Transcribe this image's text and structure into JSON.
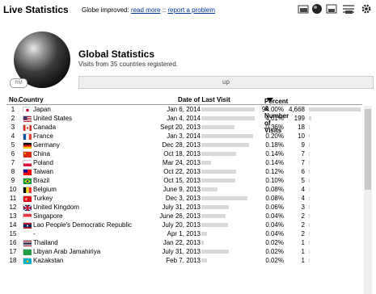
{
  "header": {
    "title": "Live Statistics",
    "message": "Globe improved:",
    "read_more": "read more",
    "separator": "::",
    "report": "report a problem",
    "icons": [
      "map-2d-icon",
      "globe-3d-icon",
      "fullscreen-icon",
      "tools-icon",
      "gear-icon"
    ]
  },
  "globe": {
    "badge": "RM"
  },
  "summary": {
    "title": "Global Statistics",
    "subtitle": "Visits from 35 countries registered.",
    "up_label": "up"
  },
  "table": {
    "headers": {
      "no": "No.",
      "country": "Country",
      "date": "Date of Last Visit",
      "percent": "Percent & Number of Visits"
    },
    "rows": [
      {
        "n": "1",
        "country": "Japan",
        "date": "Jan 6, 2014",
        "pct": "94.00%",
        "cnt": "4,668",
        "frac": 1.0,
        "flag": "jp"
      },
      {
        "n": "2",
        "country": "United States",
        "date": "Jan 4, 2014",
        "pct": "4.01%",
        "cnt": "199",
        "frac": 0.04,
        "flag": "us"
      },
      {
        "n": "3",
        "country": "Canada",
        "date": "Sept 20, 2013",
        "pct": "0.36%",
        "cnt": "18",
        "frac": 0.0036,
        "flag": "ca"
      },
      {
        "n": "4",
        "country": "France",
        "date": "Jan 3, 2014",
        "pct": "0.20%",
        "cnt": "10",
        "frac": 0.002,
        "flag": "fr"
      },
      {
        "n": "5",
        "country": "Germany",
        "date": "Dec 28, 2013",
        "pct": "0.18%",
        "cnt": "9",
        "frac": 0.0018,
        "flag": "de"
      },
      {
        "n": "6",
        "country": "China",
        "date": "Oct 18, 2013",
        "pct": "0.14%",
        "cnt": "7",
        "frac": 0.0014,
        "flag": "cn"
      },
      {
        "n": "7",
        "country": "Poland",
        "date": "Mar 24, 2013",
        "pct": "0.14%",
        "cnt": "7",
        "frac": 0.0014,
        "flag": "pl"
      },
      {
        "n": "8",
        "country": "Taiwan",
        "date": "Oct 22, 2013",
        "pct": "0.12%",
        "cnt": "6",
        "frac": 0.0012,
        "flag": "tw"
      },
      {
        "n": "9",
        "country": "Brazil",
        "date": "Oct 15, 2013",
        "pct": "0.10%",
        "cnt": "5",
        "frac": 0.001,
        "flag": "br"
      },
      {
        "n": "10",
        "country": "Belgium",
        "date": "June 9, 2013",
        "pct": "0.08%",
        "cnt": "4",
        "frac": 0.0008,
        "flag": "be"
      },
      {
        "n": "11",
        "country": "Turkey",
        "date": "Dec 3, 2013",
        "pct": "0.08%",
        "cnt": "4",
        "frac": 0.0008,
        "flag": "tr"
      },
      {
        "n": "12",
        "country": "United Kingdom",
        "date": "July 31, 2013",
        "pct": "0.06%",
        "cnt": "3",
        "frac": 0.0006,
        "flag": "gb"
      },
      {
        "n": "13",
        "country": "Singapore",
        "date": "June 26, 2013",
        "pct": "0.04%",
        "cnt": "2",
        "frac": 0.0004,
        "flag": "sg"
      },
      {
        "n": "14",
        "country": "Lao People's Democratic Republic",
        "date": "July 20, 2013",
        "pct": "0.04%",
        "cnt": "2",
        "frac": 0.0004,
        "flag": "la"
      },
      {
        "n": "15",
        "country": "-",
        "date": "Apr 1, 2013",
        "pct": "0.04%",
        "cnt": "2",
        "frac": 0.0004,
        "flag": "none"
      },
      {
        "n": "16",
        "country": "Thailand",
        "date": "Jan 22, 2013",
        "pct": "0.02%",
        "cnt": "1",
        "frac": 0.0002,
        "flag": "th"
      },
      {
        "n": "17",
        "country": "Libyan Arab Jamahiriya",
        "date": "July 31, 2013",
        "pct": "0.02%",
        "cnt": "1",
        "frac": 0.0002,
        "flag": "ly"
      },
      {
        "n": "18",
        "country": "Kazakstan",
        "date": "Feb 7, 2013",
        "pct": "0.02%",
        "cnt": "1",
        "frac": 0.0002,
        "flag": "kz"
      }
    ],
    "date_bar_fracs": [
      1.0,
      1.0,
      0.62,
      0.97,
      0.9,
      0.65,
      0.18,
      0.65,
      0.63,
      0.3,
      0.86,
      0.52,
      0.45,
      0.5,
      0.1,
      0.05,
      0.52,
      0.1
    ]
  }
}
